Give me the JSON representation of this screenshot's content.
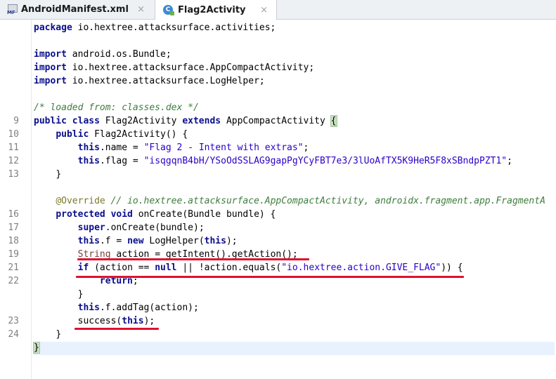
{
  "tabs": [
    {
      "label": "AndroidManifest.xml",
      "icon": "manifest-file-icon",
      "icon_text": "MF",
      "close": "×"
    },
    {
      "label": "Flag2Activity",
      "icon": "java-class-icon",
      "icon_text": "C",
      "close": "×"
    }
  ],
  "gutter": {
    "line_numbers": [
      "9",
      "10",
      "11",
      "12",
      "13",
      "16",
      "17",
      "18",
      "19",
      "21",
      "22",
      "23",
      "24"
    ]
  },
  "code": {
    "package_kw": "package",
    "package_name": " io.hextree.attacksurface.activities;",
    "import_kw": "import",
    "import1": " android.os.Bundle;",
    "import2": " io.hextree.attacksurface.AppCompactActivity;",
    "import3": " io.hextree.attacksurface.LogHelper;",
    "comment_loaded": "/* loaded from: classes.dex */",
    "class_public": "public class",
    "class_name": " Flag2Activity ",
    "class_extends": "extends",
    "class_parent": " AppCompactActivity ",
    "open_brace": "{",
    "ctor_public": "public",
    "ctor_sig": " Flag2Activity() {",
    "this_kw": "this",
    "name_assign": ".name = ",
    "name_value": "\"Flag 2 - Intent with extras\"",
    "semicolon": ";",
    "flag_assign": ".flag = ",
    "flag_value": "\"isqgqnB4bH/YSoOdSSLAG9gapPgYCyFBT7e3/3lUoAfTX5K9HeR5F8xSBndpPZT1\"",
    "close_brace": "}",
    "override_ann": "@Override",
    "override_comment": " // io.hextree.attacksurface.AppCompactActivity, androidx.fragment.app.FragmentA",
    "protected_void": "protected void",
    "oncreate_sig": " onCreate(Bundle bundle) {",
    "super_kw": "super",
    "super_call": ".onCreate(bundle);",
    "f_assign": ".f = ",
    "new_kw": "new",
    "loghelper_call": " LogHelper(",
    "loghelper_end": ");",
    "string_type": "String",
    "action_assign": " action = getIntent().getAction();",
    "if_kw": "if",
    "if_cond_a": " (action == ",
    "null_kw": "null",
    "if_cond_b": " || !action.equals(",
    "give_flag": "\"io.hextree.action.GIVE_FLAG\"",
    "if_cond_c": ")) {",
    "return_kw": "return",
    "addtag_call": ".f.addTag(action);",
    "success_call": "success(",
    "success_end": ");"
  },
  "colors": {
    "keyword": "#0a0e8c",
    "comment": "#3e7d3e",
    "string": "#2a00c8",
    "annotation": "#7a7a2a",
    "highlight_underline": "#e0112f"
  }
}
